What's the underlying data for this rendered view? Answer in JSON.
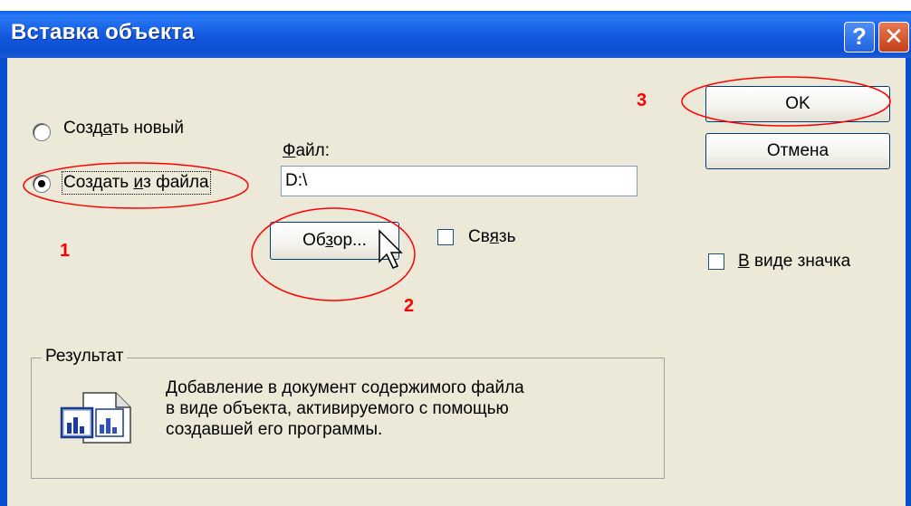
{
  "window": {
    "title": "Вставка объекта",
    "help_label": "?",
    "close_label": "✕"
  },
  "options": {
    "create_new": {
      "pre": "Созд",
      "key": "а",
      "post": "ть новый",
      "selected": false
    },
    "create_from_file": {
      "pre": "Создать ",
      "key": "и",
      "post": "з файла",
      "selected": true
    }
  },
  "file": {
    "label_key": "Ф",
    "label_rest": "айл:",
    "value": "D:\\"
  },
  "browse_button": {
    "pre": "Об",
    "key": "з",
    "post": "ор..."
  },
  "link_checkbox": {
    "pre": "Св",
    "key": "я",
    "post": "зь",
    "checked": false
  },
  "ok_button": {
    "label": "OK"
  },
  "cancel_button": {
    "label": "Отмена"
  },
  "icon_checkbox": {
    "key": "В",
    "post": " виде значка",
    "checked": false
  },
  "result": {
    "title": "Результат",
    "lines": [
      "Добавление в документ содержимого файла",
      "в виде объекта, активируемого с помощью",
      "создавшей его программы."
    ]
  },
  "annotations": [
    "1",
    "2",
    "3"
  ],
  "colors": {
    "annotation": "#ff0000",
    "titlebar": "#0b4fd1",
    "dialog_bg": "#ece9d8"
  }
}
